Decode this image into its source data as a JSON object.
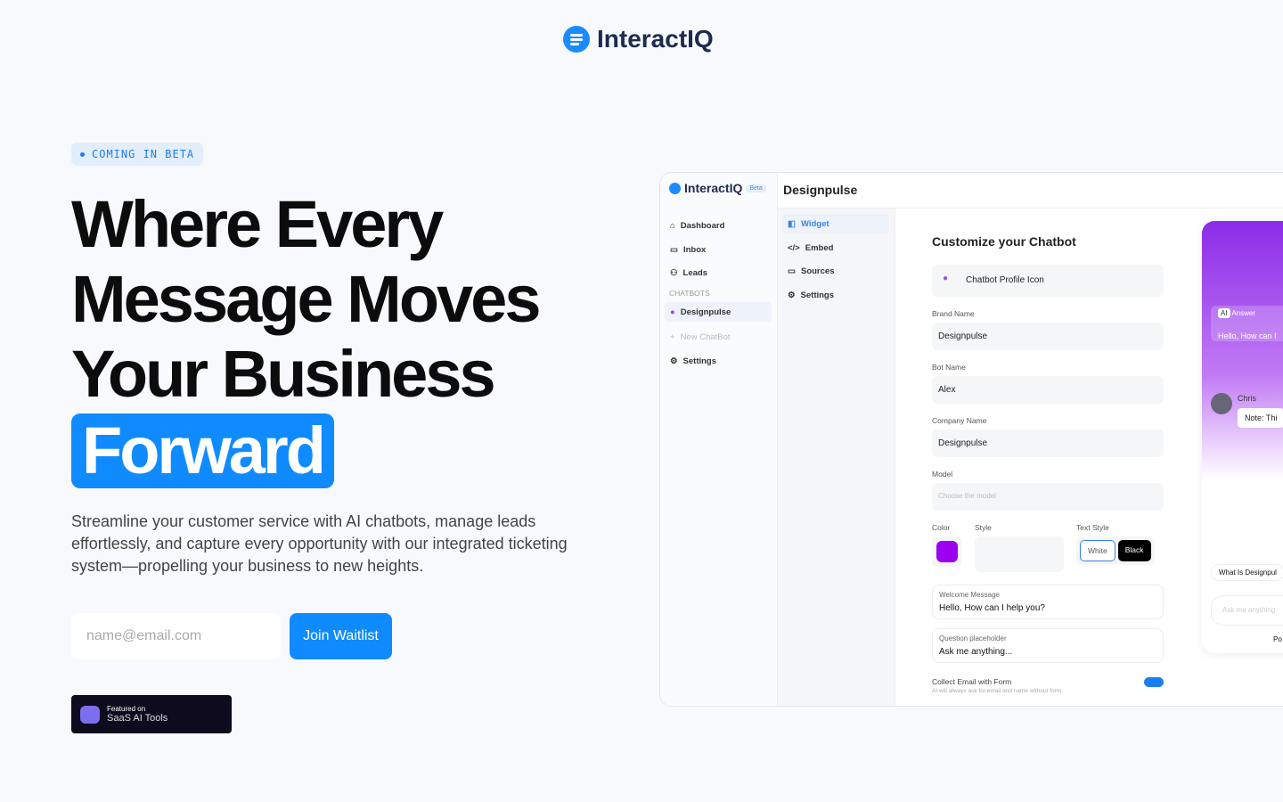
{
  "header": {
    "logo": "InteractIQ"
  },
  "hero": {
    "badge": "COMING IN BETA",
    "title_lines": [
      "Where Every",
      "Message Moves",
      "Your Business"
    ],
    "highlight": "Forward",
    "subtitle": "Streamline your customer service with AI chatbots, manage leads effortlessly, and capture every opportunity with our integrated ticketing system—propelling your business to new heights.",
    "email_placeholder": "name@email.com",
    "join_label": "Join Waitlist",
    "featured_small": "Featured on",
    "featured_name": "SaaS AI Tools"
  },
  "app": {
    "brand": "InteractIQ",
    "beta": "Beta",
    "title": "Designpulse",
    "nav": [
      "Dashboard",
      "Inbox",
      "Leads"
    ],
    "section": "CHATBOTS",
    "bot": "Designpulse",
    "new_bot": "New ChatBot",
    "settings": "Settings",
    "subnav": [
      "Widget",
      "Embed",
      "Sources",
      "Settings"
    ],
    "form": {
      "heading": "Customize your Chatbot",
      "profile_icon": "Chatbot Profile Icon",
      "brand_label": "Brand Name",
      "brand_value": "Designpulse",
      "bot_label": "Bot Name",
      "bot_value": "Alex",
      "company_label": "Company Name",
      "company_value": "Designpulse",
      "model_label": "Model",
      "model_placeholder": "Choose the model",
      "color_label": "Color",
      "color": "#9b00f0",
      "style_label": "Style",
      "text_style_label": "Text Style",
      "text_white": "White",
      "text_black": "Black",
      "welcome_label": "Welcome Message",
      "welcome_value": "Hello, How can I help you?",
      "question_label": "Question placeholder",
      "question_value": "Ask me anything...",
      "collect_label": "Collect Email with Form",
      "collect_desc": "AI will always ask for email and name without form.",
      "collect_on": true
    },
    "preview": {
      "ai": "AI",
      "answer": "Answer",
      "greeting": "Hello, How can I",
      "user": "Chris",
      "note": "Note: Thi",
      "suggestion": "What Is Designpul",
      "input": "Ask me anything",
      "powered": "Po"
    }
  }
}
